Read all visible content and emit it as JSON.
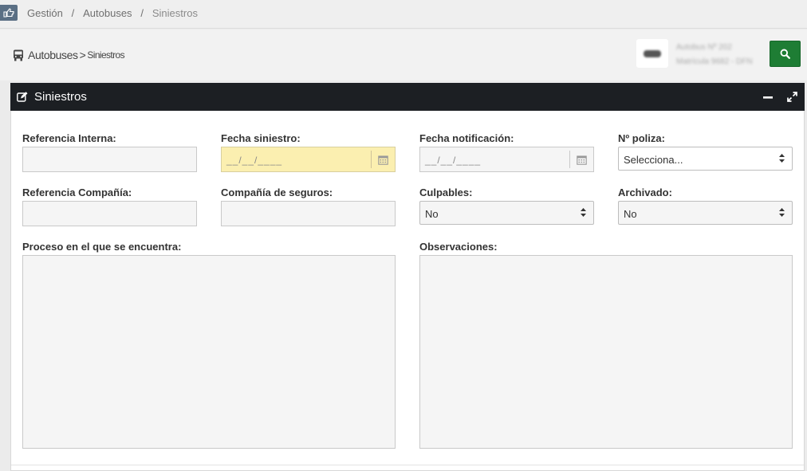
{
  "breadcrumb": {
    "items": [
      "Gestión",
      "Autobuses",
      "Siniestros"
    ],
    "separator": "/"
  },
  "page": {
    "title_main": "Autobuses",
    "title_sub": "Siniestros"
  },
  "header_right": {
    "blurred_line1": "Autobus Nº 202",
    "blurred_line2": "Matrícula 9682 - DFN"
  },
  "panel": {
    "title": "Siniestros"
  },
  "form": {
    "ref_interna_label": "Referencia Interna:",
    "ref_interna_value": "",
    "fecha_siniestro_label": "Fecha siniestro:",
    "fecha_siniestro_mask": "__/__/____",
    "fecha_notificacion_label": "Fecha notificación:",
    "fecha_notificacion_mask": "__/__/____",
    "poliza_label": "Nº poliza:",
    "poliza_value": "Selecciona...",
    "ref_compania_label": "Referencia Compañía:",
    "ref_compania_value": "",
    "compania_seguros_label": "Compañía de seguros:",
    "compania_seguros_value": "",
    "culpables_label": "Culpables:",
    "culpables_value": "No",
    "archivado_label": "Archivado:",
    "archivado_value": "No",
    "proceso_label": "Proceso en el que se encuentra:",
    "proceso_value": "",
    "observaciones_label": "Observaciones:",
    "observaciones_value": ""
  },
  "colors": {
    "panel_header": "#1c1f23",
    "search_button": "#1e7d34",
    "highlight_field": "#fbefb0"
  }
}
